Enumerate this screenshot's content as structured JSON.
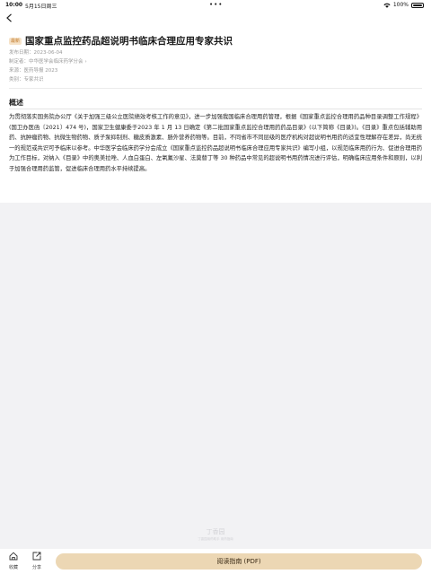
{
  "status_bar": {
    "time": "10:00",
    "date": "5月15日周三",
    "dots": "•••",
    "battery": "100%"
  },
  "header": {
    "back_icon": "chevron-left-icon",
    "tag": "最新",
    "title": "国家重点监控药品超说明书临床合理应用专家共识"
  },
  "meta": [
    {
      "label": "发布日期：",
      "value": "2023-06-04"
    },
    {
      "label": "制定者：",
      "value": "中华医学会临床药学分会",
      "chevron": "›"
    },
    {
      "label": "来源：",
      "value": "医药导报 2023"
    },
    {
      "label": "类别：",
      "value": "专家共识"
    }
  ],
  "summary": {
    "title": "概述",
    "text": "为贯彻落实国务院办公厅《关于加强三级公立医院绩效考核工作的意见》，进一步加强我国临床合理用药管理，根据《国家重点监控合理用药品种目录调整工作规程》(国卫办医函〔2021〕474 号)，国家卫生健康委于2023 年 1 月 13 日确定《第二批国家重点监控合理用药药品目录》(以下简称《目录》)。《目录》重点包括辅助用药、抗肿瘤药物、抗微生物药物、质子泵抑制剂、糖皮质激素、肠外营养药物等。目前，不同省市不同层级的医疗机构对超说明书用药的适宜性理解存在差异，尚无统一的规范或共识可予临床以参考。中华医学会临床药学分会成立《国家重点监控药品超说明书临床合理应用专家共识》编写小组，以规范临床用药行为、促进合理用药为工作目标，对纳入《目录》中的奥美拉唑、人血白蛋白、左氧氟沙星、法莫替丁等 30 种药品中常见的超说明书用药情况进行评估，明确临床应用条件和原则，以利于加强合理用药监管，促进临床合理用药水平持续提高。"
  },
  "watermark": {
    "logo": "丁香园",
    "sub": "丁香园用药助手 用药指南"
  },
  "bottom_bar": {
    "collect_label": "收藏",
    "collect_icon": "home-bookmark-icon",
    "share_label": "分享",
    "share_icon": "share-icon",
    "read_button": "阅读指南 (PDF)"
  }
}
